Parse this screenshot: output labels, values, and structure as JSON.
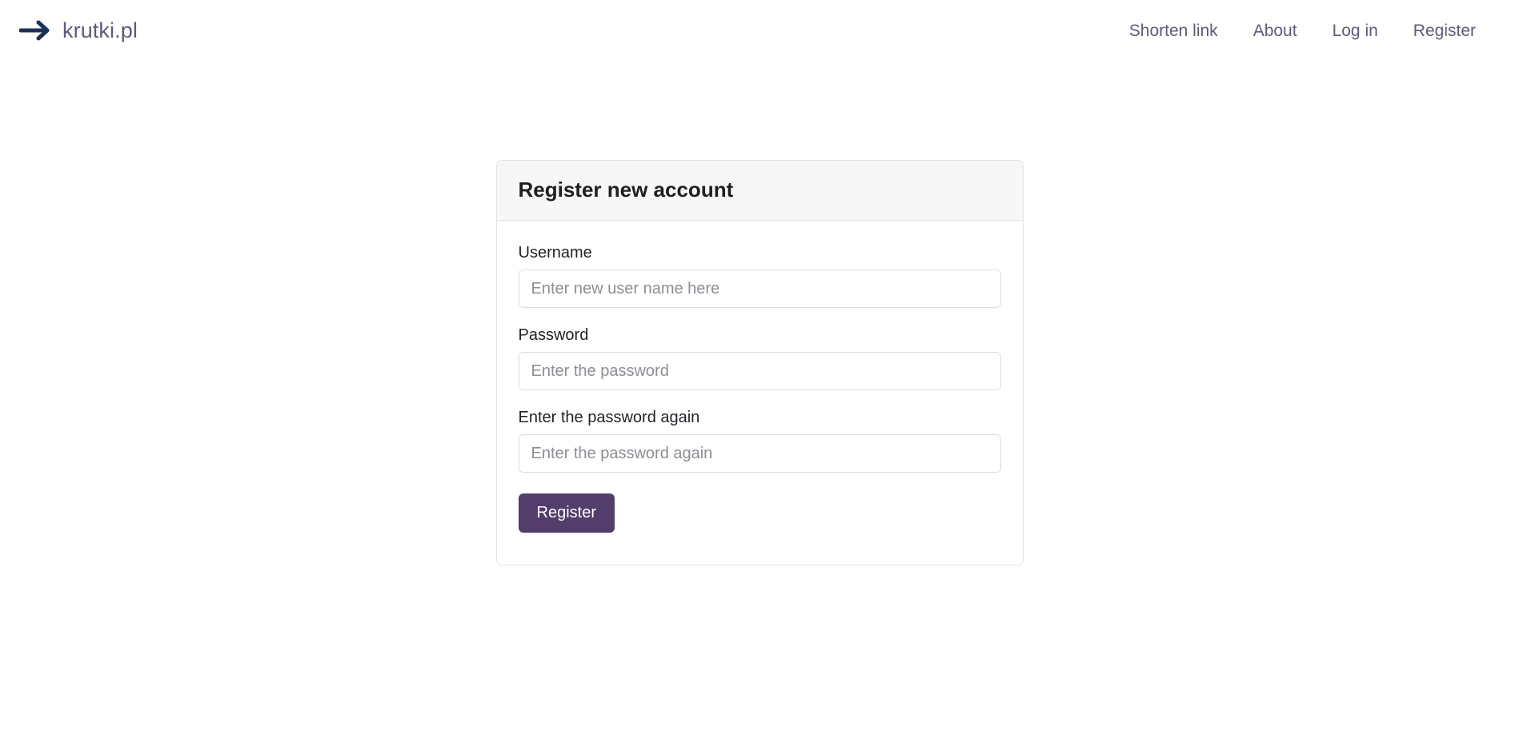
{
  "navbar": {
    "brand": {
      "icon": "arrow-right-icon",
      "text": "krutki.pl",
      "arrow_color": "#1b3055",
      "text_color": "#5f5a7a"
    },
    "links": [
      {
        "label": "Shorten link"
      },
      {
        "label": "About"
      },
      {
        "label": "Log in"
      },
      {
        "label": "Register"
      }
    ]
  },
  "card": {
    "title": "Register new account",
    "header_background": "#f7f7f7",
    "border_color": "#e3e3e5"
  },
  "form": {
    "fields": [
      {
        "label": "Username",
        "placeholder": "Enter new user name here",
        "value": "",
        "type": "text"
      },
      {
        "label": "Password",
        "placeholder": "Enter the password",
        "value": "",
        "type": "password"
      },
      {
        "label": "Enter the password again",
        "placeholder": "Enter the password again",
        "value": "",
        "type": "password"
      }
    ],
    "submit": {
      "label": "Register",
      "background": "#533d6b",
      "text_color": "#ffffff"
    }
  }
}
